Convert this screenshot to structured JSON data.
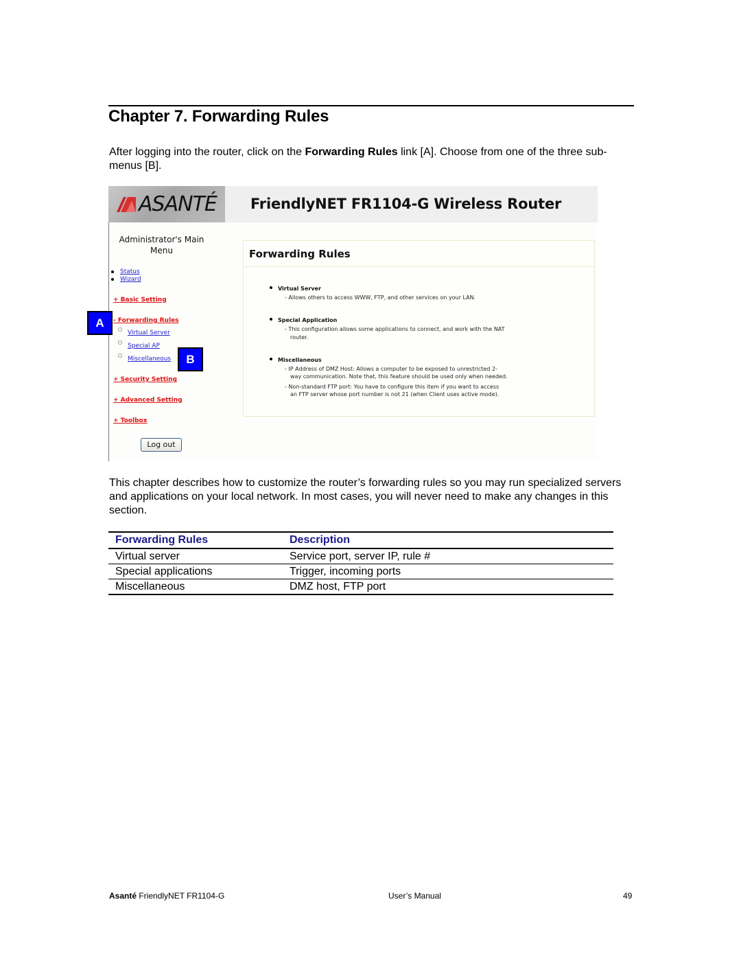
{
  "chapter": {
    "title": "Chapter 7. Forwarding Rules",
    "intro_before": "After logging into the router, click on the ",
    "intro_bold": "Forwarding Rules",
    "intro_after": " link [A]. Choose from one of the three sub-menus [B]."
  },
  "screenshot": {
    "logo_text": "ASANTÉ",
    "header_title": "FriendlyNET FR1104-G Wireless Router",
    "menu_title_line1": "Administrator's Main",
    "menu_title_line2": "Menu",
    "menu_links": [
      {
        "label": "Status"
      },
      {
        "label": "Wizard"
      }
    ],
    "sections": [
      {
        "label": "+ Basic Setting"
      },
      {
        "label": "- Forwarding Rules"
      },
      {
        "label": "+ Security Setting"
      },
      {
        "label": "+ Advanced Setting"
      },
      {
        "label": "+ Toolbox"
      }
    ],
    "submenu": [
      {
        "label": "Virtual Server"
      },
      {
        "label": "Special AP"
      },
      {
        "label": "Miscellaneous"
      }
    ],
    "logout_label": "Log out",
    "panel_title": "Forwarding Rules",
    "features": [
      {
        "name": "Virtual Server",
        "desc": [
          "- Allows others to access WWW, FTP, and other services on your LAN."
        ]
      },
      {
        "name": "Special Application",
        "desc": [
          "- This configuration allows some applications to connect, and work with the NAT",
          "  router."
        ]
      },
      {
        "name": "Miscellaneous",
        "desc": [
          "- IP Address of DMZ Host: Allows a computer to be exposed to unrestricted 2-",
          "  way communication. Note that, this feature should be used only when needed.",
          "- Non-standard FTP port: You have to configure this item if you want to access",
          "  an FTP server whose port number is not 21 (when Client uses active mode)."
        ]
      }
    ],
    "callout_a": "A",
    "callout_b": "B",
    "colors": {
      "link": "#2222cc",
      "section": "#dd1111",
      "callout": "#0000ff"
    }
  },
  "body_text": "This chapter describes how to customize the router’s forwarding rules so you may run specialized servers and applications on your local network. In most cases, you will never need to make any changes in this section.",
  "table": {
    "headers": [
      "Forwarding Rules",
      "Description"
    ],
    "rows": [
      [
        "Virtual server",
        "Service port, server IP, rule #"
      ],
      [
        "Special applications",
        "Trigger, incoming ports"
      ],
      [
        "Miscellaneous",
        "DMZ host, FTP port"
      ]
    ],
    "header_color": "#1a1a8a"
  },
  "footer": {
    "brand": "Asanté",
    "product": " FriendlyNET FR1104-G",
    "center": "User’s Manual",
    "page": "49"
  }
}
